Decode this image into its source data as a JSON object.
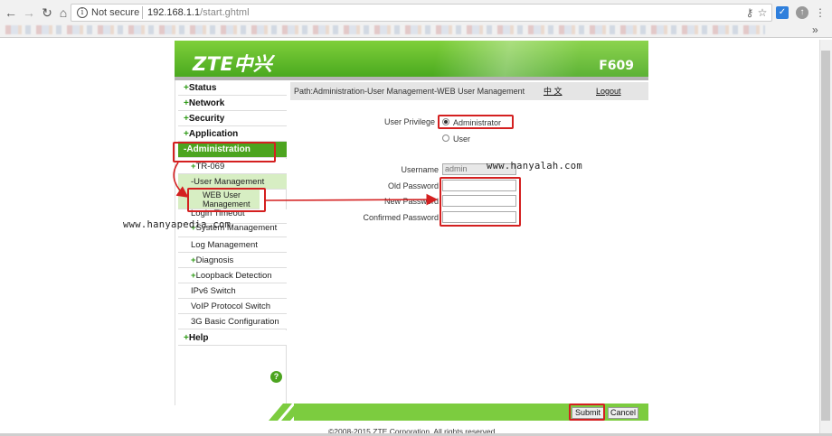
{
  "browser": {
    "security_label": "Not secure",
    "url_host": "192.168.1.1",
    "url_path": "/start.ghtml",
    "more_bookmarks": "»",
    "icons": [
      "back-icon",
      "forward-icon",
      "reload-icon",
      "home-icon",
      "info-icon",
      "key-icon",
      "star-icon",
      "extension-icon",
      "profile-icon",
      "menu-icon"
    ]
  },
  "header": {
    "logo": "ZTE中兴",
    "model": "F609"
  },
  "sidebar": {
    "items": [
      {
        "prefix": "+",
        "label": "Status"
      },
      {
        "prefix": "+",
        "label": "Network"
      },
      {
        "prefix": "+",
        "label": "Security"
      },
      {
        "prefix": "+",
        "label": "Application"
      },
      {
        "prefix": "-",
        "label": "Administration"
      },
      {
        "prefix": "+",
        "label": "TR-069"
      },
      {
        "prefix": "-",
        "label": "User Management"
      },
      {
        "prefix": "",
        "label": "WEB User Management"
      },
      {
        "prefix": "",
        "label": "Login Timeout"
      },
      {
        "prefix": "+",
        "label": "System Management"
      },
      {
        "prefix": "",
        "label": "Log Management"
      },
      {
        "prefix": "+",
        "label": "Diagnosis"
      },
      {
        "prefix": "+",
        "label": "Loopback Detection"
      },
      {
        "prefix": "",
        "label": "IPv6 Switch"
      },
      {
        "prefix": "",
        "label": "VoIP Protocol Switch"
      },
      {
        "prefix": "",
        "label": "3G Basic Configuration"
      },
      {
        "prefix": "+",
        "label": "Help"
      }
    ],
    "help_icon": "?"
  },
  "path": {
    "text": "Path:Administration-User Management-WEB User Management",
    "lang": "中 文",
    "logout": "Logout"
  },
  "form": {
    "privilege_label": "User Privilege",
    "option_admin": "Administrator",
    "option_user": "User",
    "username_label": "Username",
    "username_value": "admin",
    "old_password_label": "Old Password",
    "new_password_label": "New Password",
    "confirm_password_label": "Confirmed Password"
  },
  "footer": {
    "submit": "Submit",
    "cancel": "Cancel",
    "copyright": "©2008-2015 ZTE Corporation. All rights reserved."
  },
  "watermarks": {
    "left": "www.hanyapedia.com",
    "right": "www.hanyalah.com"
  },
  "colors": {
    "brand_green": "#4ca41f",
    "annotation_red": "#d42020"
  }
}
